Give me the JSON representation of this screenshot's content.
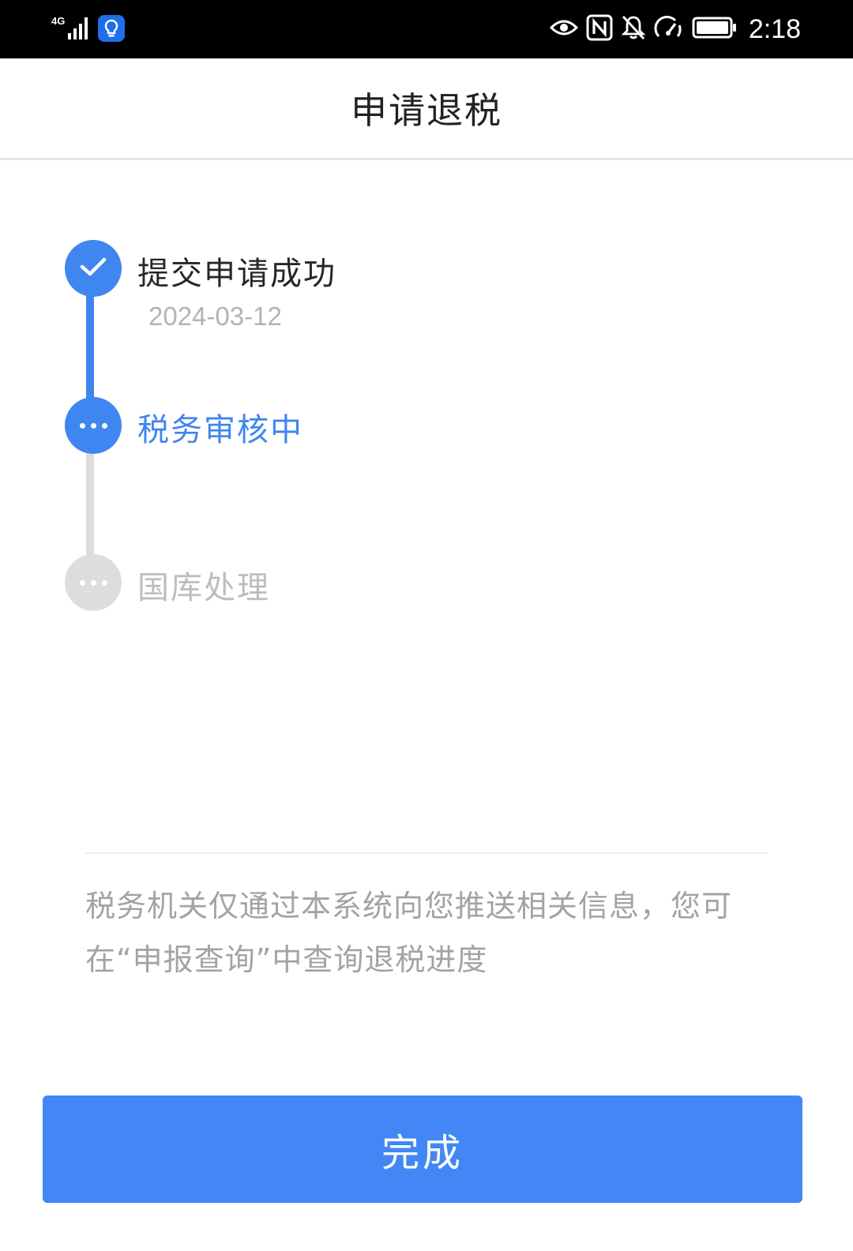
{
  "status_bar": {
    "network_label": "4G",
    "time": "2:18",
    "icons": [
      "signal-icon",
      "bulb-app-icon",
      "eye-icon",
      "nfc-icon",
      "mute-bell-icon",
      "speed-icon",
      "battery-icon"
    ]
  },
  "header": {
    "title": "申请退税"
  },
  "timeline": {
    "steps": [
      {
        "label": "提交申请成功",
        "date": "2024-03-12",
        "state": "done"
      },
      {
        "label": "税务审核中",
        "state": "active"
      },
      {
        "label": "国库处理",
        "state": "pending"
      }
    ]
  },
  "notice": {
    "text": "税务机关仅通过本系统向您推送相关信息，您可在“申报查询”中查询退税进度"
  },
  "actions": {
    "done_label": "完成"
  },
  "colors": {
    "accent": "#3f86f0",
    "button": "#4287f5",
    "pending": "#dddddd",
    "muted_text": "#a3a3a3"
  }
}
